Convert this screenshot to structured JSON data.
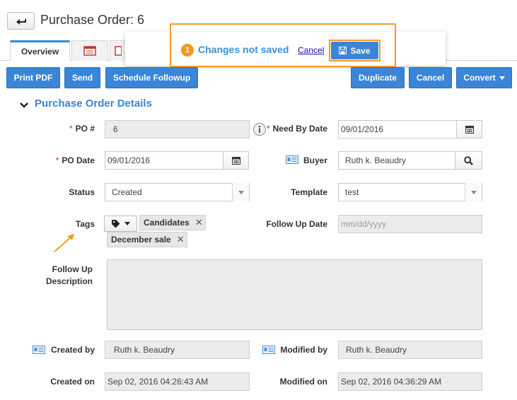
{
  "header": {
    "title": "Purchase Order: 6"
  },
  "tabs": {
    "overview_label": "Overview"
  },
  "notification": {
    "count": "1",
    "message": "Changes not saved",
    "cancel_label": "Cancel",
    "save_label": "Save"
  },
  "toolbar": {
    "print_pdf": "Print PDF",
    "send": "Send",
    "schedule_followup": "Schedule Followup",
    "duplicate": "Duplicate",
    "cancel": "Cancel",
    "convert": "Convert"
  },
  "section": {
    "title": "Purchase Order Details"
  },
  "form": {
    "po_number": {
      "label": "PO #",
      "value": "6"
    },
    "need_by_date": {
      "label": "Need By Date",
      "value": "09/01/2016"
    },
    "po_date": {
      "label": "PO Date",
      "value": "09/01/2016"
    },
    "buyer": {
      "label": "Buyer",
      "value": "Ruth k. Beaudry"
    },
    "status": {
      "label": "Status",
      "value": "Created"
    },
    "template": {
      "label": "Template",
      "value": "test"
    },
    "tags": {
      "label": "Tags",
      "items": [
        "Candidates",
        "December sale"
      ]
    },
    "follow_up_date": {
      "label": "Follow Up Date",
      "placeholder": "mm/dd/yyyy"
    },
    "follow_up_description": {
      "label_line1": "Follow Up",
      "label_line2": "Description",
      "value": ""
    },
    "created_by": {
      "label": "Created by",
      "value": "Ruth k. Beaudry"
    },
    "modified_by": {
      "label": "Modified by",
      "value": "Ruth k. Beaudry"
    },
    "created_on": {
      "label": "Created on",
      "value": "Sep 02, 2016 04:26:43 AM"
    },
    "modified_on": {
      "label": "Modified on",
      "value": "Sep 02, 2016 04:36:29 AM"
    }
  },
  "icons": {
    "back": "back-arrow-icon",
    "calendar": "calendar-icon",
    "search": "search-icon",
    "contact_card": "contact-card-icon",
    "tag": "tag-icon",
    "info": "info-icon",
    "save": "floppy-disk-icon",
    "annotation": "arrow-annotation-icon"
  },
  "colors": {
    "primary": "#3a85d6",
    "highlight": "#f29a24",
    "required": "#d9251c"
  }
}
